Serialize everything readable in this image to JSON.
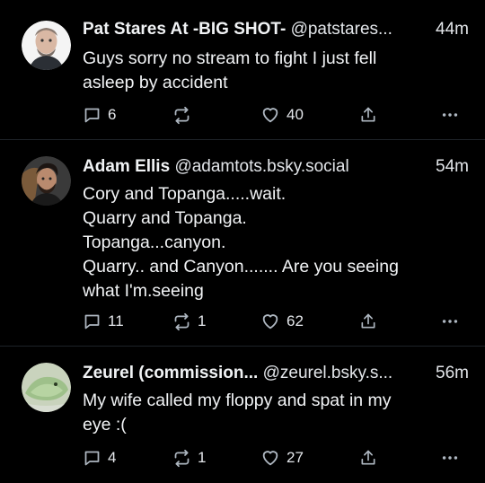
{
  "posts": [
    {
      "name": "Pat Stares At -BIG SHOT-",
      "handle": "@patstares...",
      "time": "44m",
      "lines": [
        "Guys sorry no stream to fight I just fell",
        "asleep by accident"
      ],
      "replies": "6",
      "reposts": "",
      "likes": "40"
    },
    {
      "name": "Adam Ellis",
      "handle": "@adamtots.bsky.social",
      "time": "54m",
      "lines": [
        "Cory and Topanga.....wait.",
        "Quarry and Topanga.",
        "Topanga...canyon.",
        "Quarry.. and Canyon....... Are you seeing",
        "what I'm.seeing"
      ],
      "replies": "11",
      "reposts": "1",
      "likes": "62"
    },
    {
      "name": "Zeurel (commission...",
      "handle": "@zeurel.bsky.s...",
      "time": "56m",
      "lines": [
        "My wife called my floppy and spat in my",
        "eye :("
      ],
      "replies": "4",
      "reposts": "1",
      "likes": "27"
    }
  ],
  "icons": {
    "reply": "reply-icon",
    "repost": "repost-icon",
    "like": "heart-icon",
    "share": "share-icon",
    "more": "more-icon"
  },
  "colors": {
    "background": "#000000",
    "text": "#f1f3f5",
    "icon": "#aeb7c1",
    "divider": "#1e2329"
  }
}
